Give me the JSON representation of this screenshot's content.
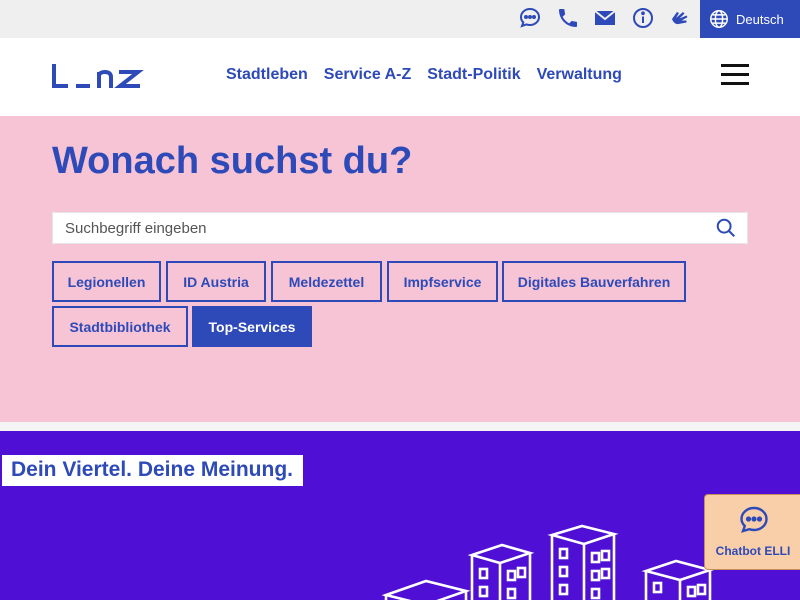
{
  "topbar": {
    "icons": [
      "chat-icon",
      "phone-icon",
      "mail-icon",
      "info-icon",
      "sign-language-icon"
    ],
    "language": "Deutsch"
  },
  "header": {
    "logo": "L_nz",
    "nav": [
      "Stadtleben",
      "Service A-Z",
      "Stadt-Politik",
      "Verwaltung"
    ]
  },
  "search": {
    "title": "Wonach suchst du?",
    "placeholder": "Suchbegriff eingeben",
    "chips": [
      "Legionellen",
      "ID Austria",
      "Meldezettel",
      "Impfservice",
      "Digitales Bauverfahren",
      "Stadtbibliothek",
      "Top-Services"
    ],
    "active_chip": "Top-Services"
  },
  "banner": {
    "title": "Dein Viertel. Deine Meinung."
  },
  "chatbot": {
    "label": "Chatbot ELLI"
  },
  "colors": {
    "brand_blue": "#2e4ab8",
    "search_bg": "#f6c4d4",
    "banner_bg": "#4f0fd4",
    "chatbot_bg": "#f8cfa8"
  }
}
